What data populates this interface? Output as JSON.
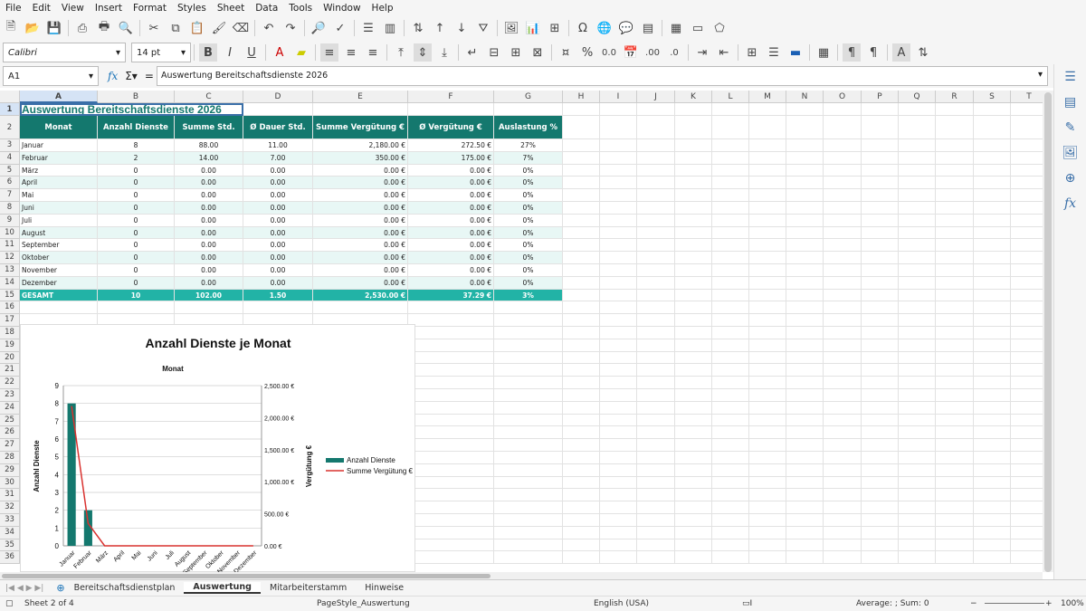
{
  "menu": [
    "File",
    "Edit",
    "View",
    "Insert",
    "Format",
    "Styles",
    "Sheet",
    "Data",
    "Tools",
    "Window",
    "Help"
  ],
  "font": {
    "name": "Calibri",
    "size": "14 pt"
  },
  "namebox": "A1",
  "formula": "Auswertung Bereitschaftsdienste 2026",
  "columns": [
    "A",
    "B",
    "C",
    "D",
    "E",
    "F",
    "G",
    "H",
    "I",
    "J",
    "K",
    "L",
    "M",
    "N",
    "O",
    "P",
    "Q",
    "R",
    "S",
    "T"
  ],
  "rows": [
    "1",
    "2",
    "3",
    "4",
    "5",
    "6",
    "7",
    "8",
    "9",
    "10",
    "11",
    "12",
    "13",
    "14",
    "15",
    "16",
    "17",
    "18",
    "19",
    "20",
    "21",
    "22",
    "23",
    "24",
    "25",
    "26",
    "27",
    "28",
    "29",
    "30",
    "31",
    "32",
    "33",
    "34",
    "35",
    "36"
  ],
  "sheet": {
    "title": "Auswertung Bereitschaftsdienste 2026",
    "headers": [
      "Monat",
      "Anzahl Dienste",
      "Summe Std.",
      "Ø Dauer Std.",
      "Summe Vergütung €",
      "Ø Vergütung €",
      "Auslastung %"
    ],
    "data": [
      [
        "Januar",
        "8",
        "88.00",
        "11.00",
        "2,180.00 €",
        "272.50 €",
        "27%"
      ],
      [
        "Februar",
        "2",
        "14.00",
        "7.00",
        "350.00 €",
        "175.00 €",
        "7%"
      ],
      [
        "März",
        "0",
        "0.00",
        "0.00",
        "0.00 €",
        "0.00 €",
        "0%"
      ],
      [
        "April",
        "0",
        "0.00",
        "0.00",
        "0.00 €",
        "0.00 €",
        "0%"
      ],
      [
        "Mai",
        "0",
        "0.00",
        "0.00",
        "0.00 €",
        "0.00 €",
        "0%"
      ],
      [
        "Juni",
        "0",
        "0.00",
        "0.00",
        "0.00 €",
        "0.00 €",
        "0%"
      ],
      [
        "Juli",
        "0",
        "0.00",
        "0.00",
        "0.00 €",
        "0.00 €",
        "0%"
      ],
      [
        "August",
        "0",
        "0.00",
        "0.00",
        "0.00 €",
        "0.00 €",
        "0%"
      ],
      [
        "September",
        "0",
        "0.00",
        "0.00",
        "0.00 €",
        "0.00 €",
        "0%"
      ],
      [
        "Oktober",
        "0",
        "0.00",
        "0.00",
        "0.00 €",
        "0.00 €",
        "0%"
      ],
      [
        "November",
        "0",
        "0.00",
        "0.00",
        "0.00 €",
        "0.00 €",
        "0%"
      ],
      [
        "Dezember",
        "0",
        "0.00",
        "0.00",
        "0.00 €",
        "0.00 €",
        "0%"
      ]
    ],
    "total": [
      "GESAMT",
      "10",
      "102.00",
      "1.50",
      "2,530.00 €",
      "37.29 €",
      "3%"
    ]
  },
  "chart_data": {
    "type": "bar",
    "title": "Anzahl Dienste je Monat",
    "subtitle": "Monat",
    "categories": [
      "Januar",
      "Februar",
      "März",
      "April",
      "Mai",
      "Juni",
      "Juli",
      "August",
      "September",
      "Oktober",
      "November",
      "Dezember"
    ],
    "series": [
      {
        "name": "Anzahl Dienste",
        "type": "bar",
        "values": [
          8,
          2,
          0,
          0,
          0,
          0,
          0,
          0,
          0,
          0,
          0,
          0
        ]
      },
      {
        "name": "Summe Vergütung €",
        "type": "line",
        "values": [
          2180,
          350,
          0,
          0,
          0,
          0,
          0,
          0,
          0,
          0,
          0,
          0
        ]
      }
    ],
    "ylabel": "Anzahl Dienste",
    "y2label": "Vergütung €",
    "ylim": [
      0,
      9
    ],
    "y2lim": [
      0,
      2500
    ],
    "yticks": [
      "0",
      "1",
      "2",
      "3",
      "4",
      "5",
      "6",
      "7",
      "8",
      "9"
    ],
    "y2ticks": [
      "0.00 €",
      "500.00 €",
      "1,000.00 €",
      "1,500.00 €",
      "2,000.00 €",
      "2,500.00 €"
    ],
    "legend": "right",
    "colors": {
      "bar": "#14786e",
      "line": "#d9322f"
    }
  },
  "tabs": [
    "Bereitschaftsdienstplan",
    "Auswertung",
    "Mitarbeiterstamm",
    "Hinweise"
  ],
  "status": {
    "sheet": "Sheet 2 of 4",
    "style": "PageStyle_Auswertung",
    "lang": "English (USA)",
    "sum": "Average: ; Sum: 0",
    "zoom": "100%"
  }
}
